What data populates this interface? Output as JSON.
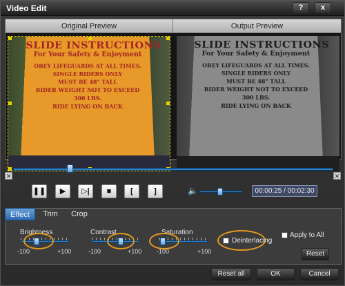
{
  "window": {
    "title": "Video Edit",
    "help_label": "?",
    "close_label": "x"
  },
  "preview": {
    "original_label": "Original Preview",
    "output_label": "Output Preview",
    "sign_lines": [
      "SLIDE INSTRUCTIONS",
      "For Your Safety & Enjoyment",
      "OBEY LIFEGUARDS AT ALL TIMES.",
      "SINGLE RIDERS ONLY",
      "MUST BE 48\" TALL",
      "RIDER WEIGHT NOT TO EXCEED",
      "300 LBS.",
      "RIDE LYING ON BACK"
    ]
  },
  "playback": {
    "progress": 0.17,
    "volume": 0.45,
    "time": "00:00:25 / 00:02:30",
    "controls": [
      "pause",
      "play",
      "next-frame",
      "stop",
      "mark-in",
      "mark-out"
    ]
  },
  "tabs": [
    {
      "label": "Effect",
      "active": true
    },
    {
      "label": "Trim",
      "active": false
    },
    {
      "label": "Crop",
      "active": false
    }
  ],
  "effect": {
    "brightness": {
      "label": "Brightness",
      "min": "-100",
      "max": "+100",
      "value": 0
    },
    "contrast": {
      "label": "Contrast",
      "min": "-100",
      "max": "+100",
      "value": 0
    },
    "saturation": {
      "label": "Saturation",
      "min": "-100",
      "max": "+100",
      "value": 0
    },
    "deinterlacing_label": "Deinterlacing",
    "apply_all_label": "Apply to All",
    "reset_label": "Reset"
  },
  "footer": {
    "reset_all": "Reset all",
    "ok": "OK",
    "cancel": "Cancel"
  },
  "colors": {
    "accent": "#2a7fc8",
    "highlight": "#e59a1f",
    "sign": "#e79a2a"
  }
}
